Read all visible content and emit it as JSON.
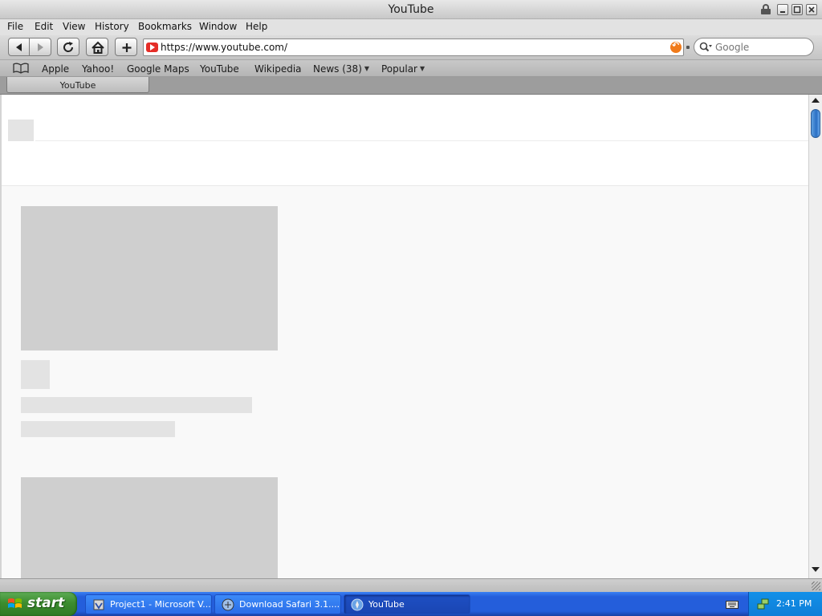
{
  "window": {
    "title": "YouTube",
    "controls": [
      "minimize",
      "maximize",
      "close"
    ]
  },
  "menubar": {
    "items": [
      "File",
      "Edit",
      "View",
      "History",
      "Bookmarks",
      "Window",
      "Help"
    ]
  },
  "toolbar": {
    "url": "https://www.youtube.com/",
    "search_placeholder": "Google"
  },
  "bookmarks": {
    "items": [
      {
        "label": "Apple"
      },
      {
        "label": "Yahoo!"
      },
      {
        "label": "Google Maps"
      },
      {
        "label": "YouTube"
      },
      {
        "label": "Wikipedia"
      },
      {
        "label": "News (38)",
        "has_menu": true
      },
      {
        "label": "Popular",
        "has_menu": true
      }
    ]
  },
  "tabs": [
    {
      "label": "YouTube",
      "active": true
    }
  ],
  "page": {
    "state": "loading skeleton",
    "placeholder_color": "#cfcfcf"
  },
  "taskbar": {
    "start_label": "start",
    "tasks": [
      {
        "label": "Project1 - Microsoft V...",
        "icon": "visual-basic-icon",
        "active": false
      },
      {
        "label": "Download Safari 3.1....",
        "icon": "safari-download-icon",
        "active": false
      },
      {
        "label": "YouTube",
        "icon": "safari-icon",
        "active": true
      }
    ],
    "clock": "2:41 PM"
  },
  "colors": {
    "taskbar_blue": "#245edb",
    "start_green": "#3c8d2f",
    "youtube_red": "#e52d27",
    "scroll_thumb_blue": "#2a6fc4"
  }
}
